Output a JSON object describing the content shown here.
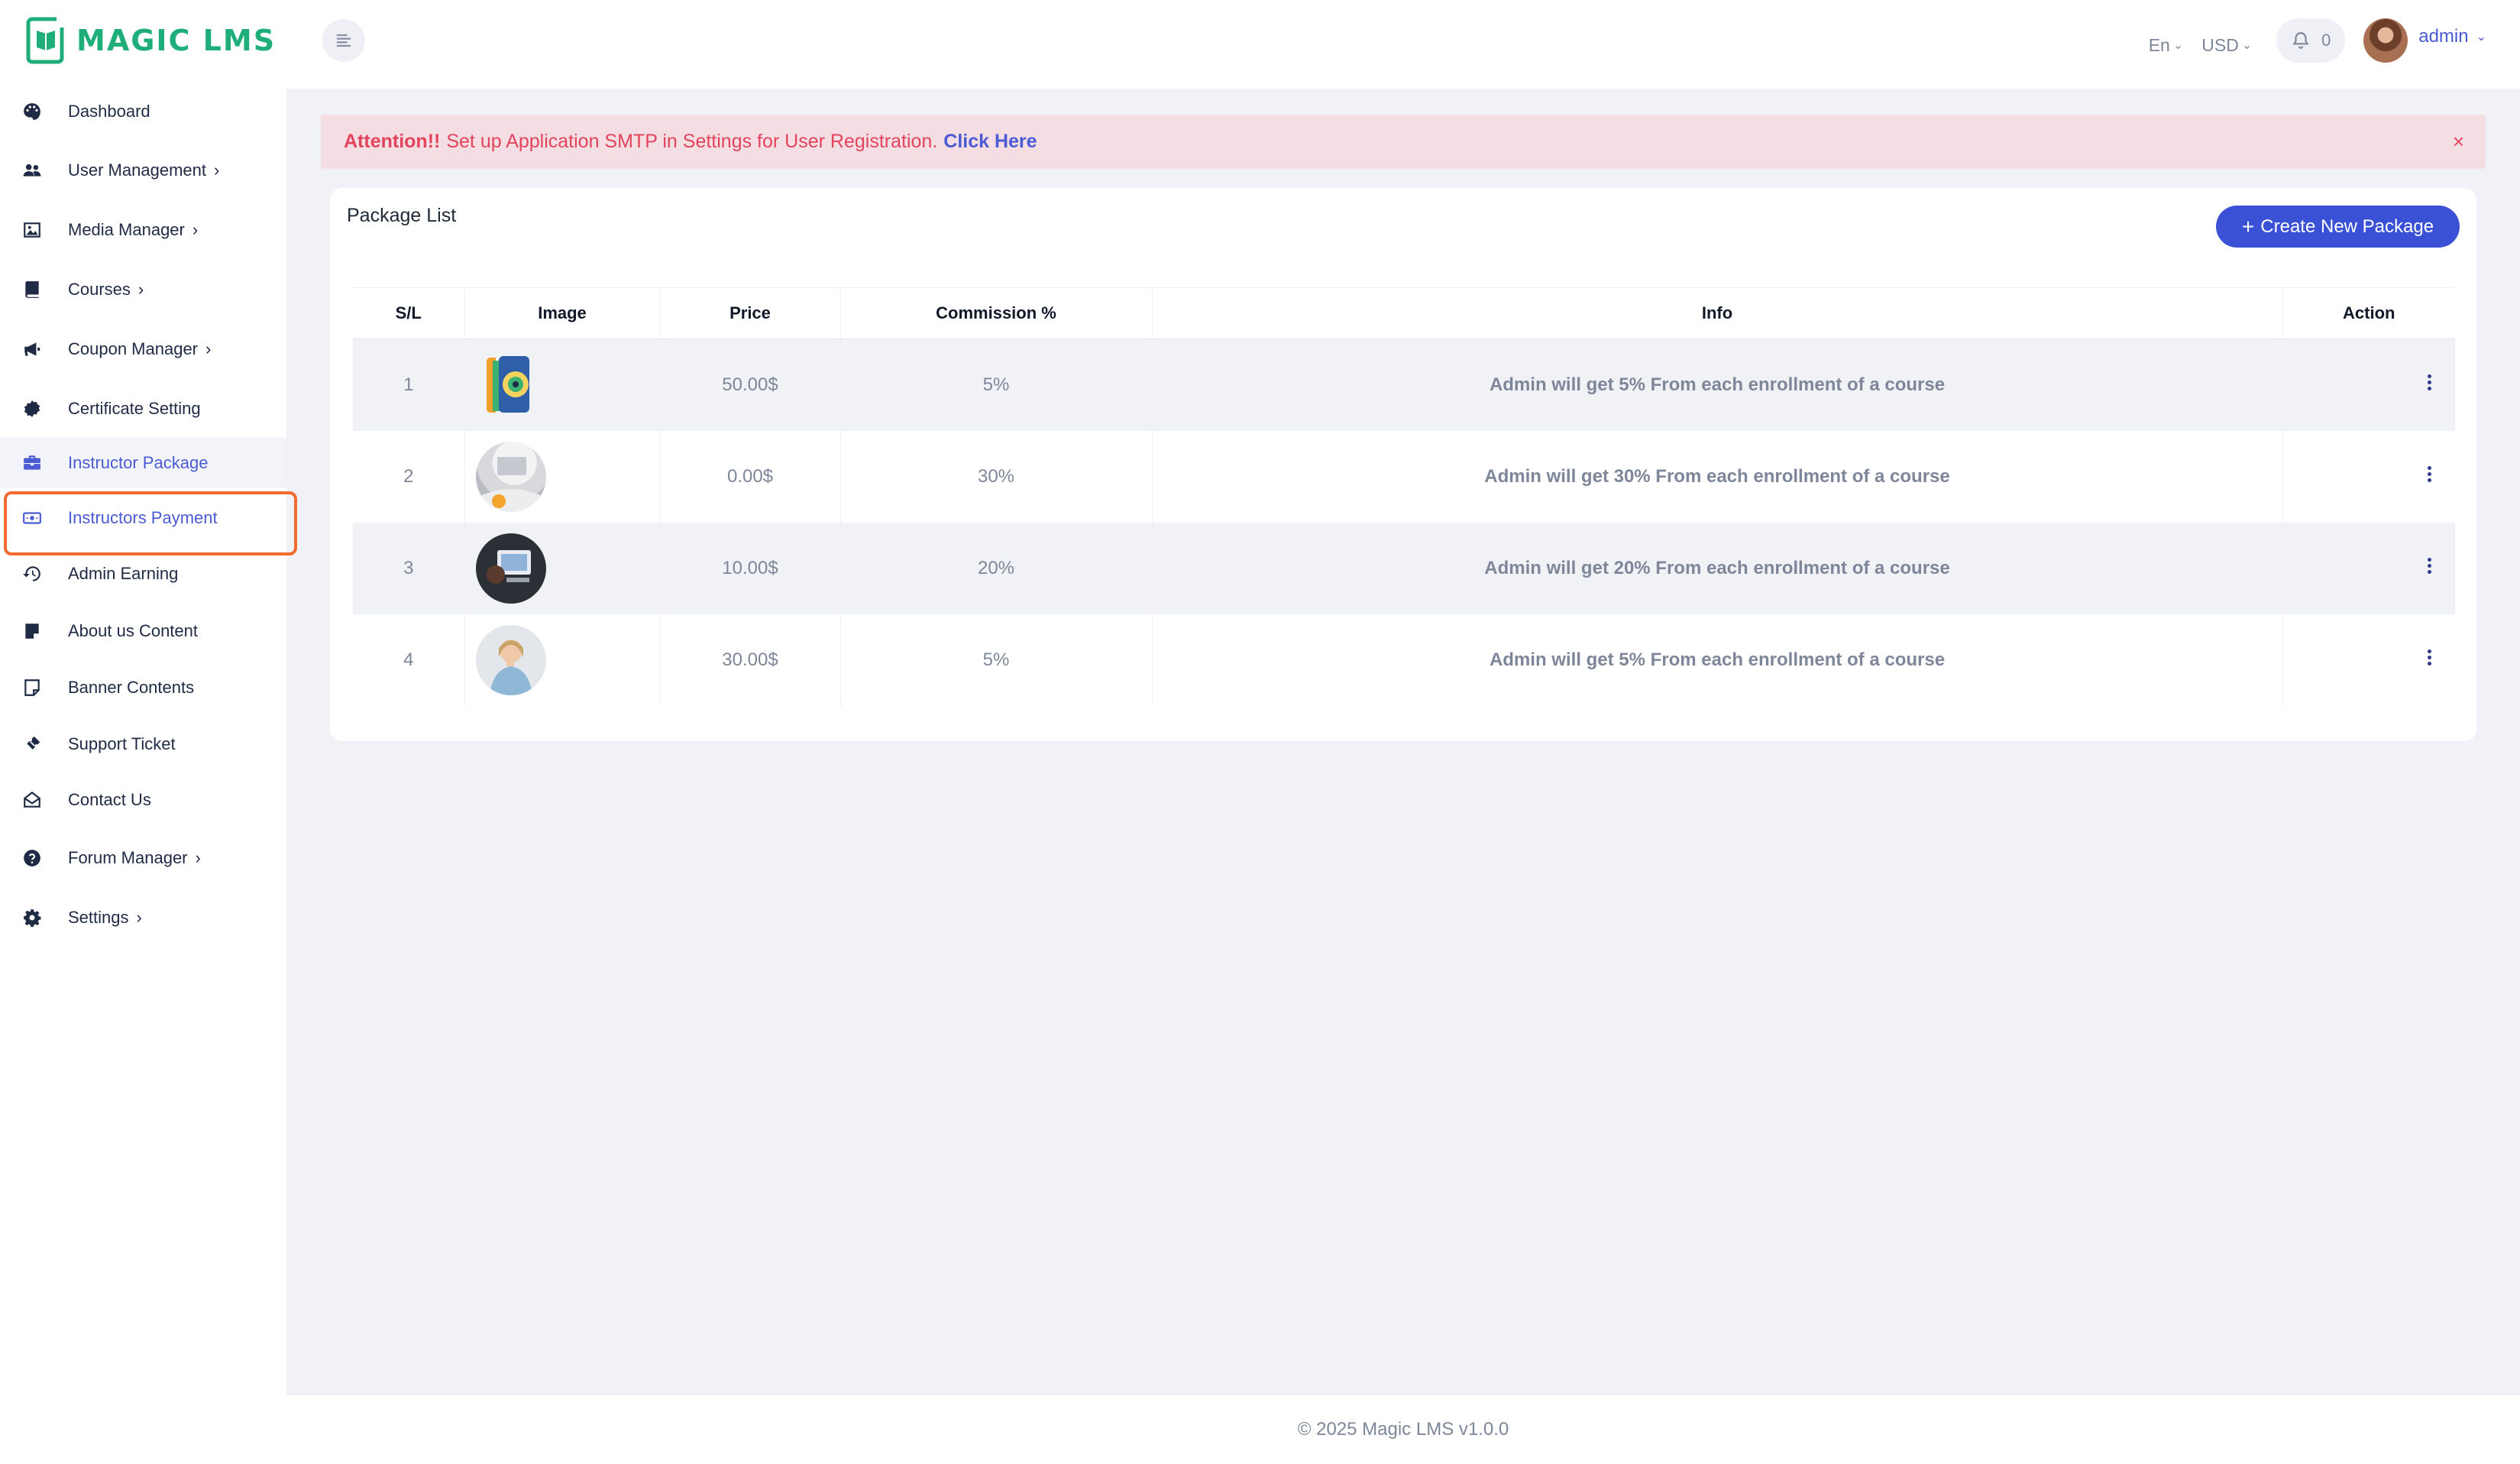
{
  "app": {
    "logo_text": "MAGIC LMS"
  },
  "sidebar": {
    "items": [
      {
        "label": "Dashboard",
        "icon": "palette-icon",
        "chevron": ""
      },
      {
        "label": "User Management",
        "icon": "users-icon",
        "chevron": "›"
      },
      {
        "label": "Media Manager",
        "icon": "image-icon",
        "chevron": "›"
      },
      {
        "label": "Courses",
        "icon": "book-icon",
        "chevron": "›"
      },
      {
        "label": "Coupon Manager",
        "icon": "megaphone-icon",
        "chevron": "›"
      },
      {
        "label": "Certificate Setting",
        "icon": "badge-icon",
        "chevron": ""
      },
      {
        "label": "Instructor Package",
        "icon": "briefcase-icon",
        "chevron": ""
      },
      {
        "label": "Instructors Payment",
        "icon": "money-bill-icon",
        "chevron": ""
      },
      {
        "label": "Admin Earning",
        "icon": "history-icon",
        "chevron": ""
      },
      {
        "label": "About us Content",
        "icon": "note-icon",
        "chevron": ""
      },
      {
        "label": "Banner Contents",
        "icon": "sticky-note-icon",
        "chevron": ""
      },
      {
        "label": "Support Ticket",
        "icon": "ticket-icon",
        "chevron": ""
      },
      {
        "label": "Contact Us",
        "icon": "envelope-open-icon",
        "chevron": ""
      },
      {
        "label": "Forum Manager",
        "icon": "question-circle-icon",
        "chevron": "›"
      },
      {
        "label": "Settings",
        "icon": "gear-icon",
        "chevron": "›"
      }
    ]
  },
  "topbar": {
    "language": "En",
    "currency": "USD",
    "notification_count": "0",
    "user_name": "admin"
  },
  "alert": {
    "strong": "Attention!!",
    "message": "Set up Application SMTP in Settings for User Registration.",
    "link": "Click Here",
    "close": "×"
  },
  "card": {
    "title": "Package List",
    "create_button": "Create New Package",
    "columns": [
      "S/L",
      "Image",
      "Price",
      "Commission %",
      "Info",
      "Action"
    ],
    "rows": [
      {
        "sl": "1",
        "price": "50.00$",
        "commission": "5%",
        "info": "Admin will get 5% From each enrollment of a course"
      },
      {
        "sl": "2",
        "price": "0.00$",
        "commission": "30%",
        "info": "Admin will get 30% From each enrollment of a course"
      },
      {
        "sl": "3",
        "price": "10.00$",
        "commission": "20%",
        "info": "Admin will get 20% From each enrollment of a course"
      },
      {
        "sl": "4",
        "price": "30.00$",
        "commission": "5%",
        "info": "Admin will get 5% From each enrollment of a course"
      }
    ]
  },
  "footer": {
    "text": "© 2025 Magic LMS v1.0.0"
  },
  "colors": {
    "accent": "#3a51d6",
    "brand": "#1fae7a",
    "alert_bg": "#f5dde4",
    "alert_text": "#e2445c",
    "highlight_border": "#f26b2f"
  }
}
